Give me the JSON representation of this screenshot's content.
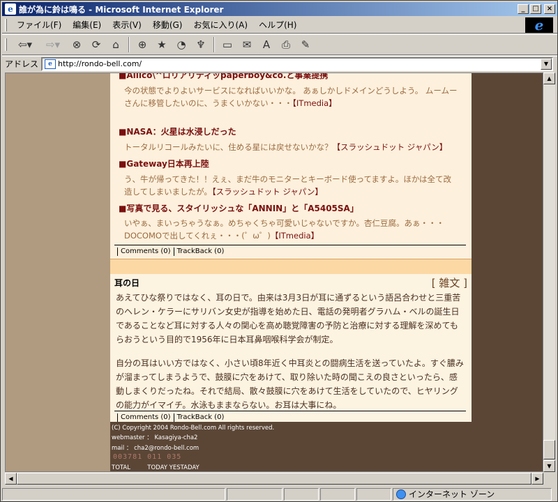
{
  "window": {
    "title": "誰が為に鈴は鳴る - Microsoft Internet Explorer",
    "icon": "ie-page-icon",
    "controls": [
      "minimize",
      "maximize",
      "close"
    ]
  },
  "menu": {
    "items": [
      "ファイル(F)",
      "編集(E)",
      "表示(V)",
      "移動(G)",
      "お気に入り(A)",
      "ヘルプ(H)"
    ]
  },
  "toolbar": {
    "buttons": [
      "back-arrow-icon",
      "forward-arrow-icon",
      "stop-icon",
      "refresh-icon",
      "home-icon",
      "search-icon",
      "favorites-icon",
      "history-icon",
      "channels-icon",
      "fullscreen-icon",
      "mail-icon",
      "font-icon",
      "print-icon",
      "edit-icon"
    ]
  },
  "address": {
    "label": "アドレス",
    "url": "http://rondo-bell.com/"
  },
  "news": [
    {
      "headline": "■Ailico\\^ロリアリティッpaperboy&co.と事業提携",
      "body": "今の状態でよりよいサービスになればいいかな。 あぁしかしドメインどうしよう。 ムームーさんに移管したいのに、うまくいかない・・・",
      "source": "【ITmedia】"
    },
    {
      "headline": "■NASA：火星は水浸しだった",
      "body": "トータルリコールみたいに、住める星には戻せないかな？",
      "source": "【スラッシュドット ジャパン】"
    },
    {
      "headline": "■Gateway日本再上陸",
      "body": "う、牛が帰ってきた！！えぇ、まだ牛のモニターとキーボード使ってますよ。ほかは全て改造してしまいましたが。",
      "source": "【スラッシュドット ジャパン】"
    },
    {
      "headline": "■写真で見る、スタイリッシュな「ANNIN」と「A5405SA」",
      "body": "いやぁ、まいっちゃうなぁ。めちゃくちゃ可愛いじゃないですか。杏仁豆腐。あぁ・・・DOCOMOで出してくれぇ・・・(゜ω゜)",
      "source": "【ITmedia】"
    }
  ],
  "meta1": {
    "comments": "Comments (0)",
    "trackback": "TrackBack (0)"
  },
  "article": {
    "title": "耳の日",
    "category": "[ 雑文 ]",
    "paragraph1": "あえてひな祭りではなく、耳の日で。由来は3月3日が耳に通ずるという語呂合わせと三重苦のヘレン・ケラーにサリバン女史が指導を始めた日、電話の発明者グラハム・ベルの誕生日であることなど耳に対する人々の関心を高め聴覚障害の予防と治療に対する理解を深めてもらおうという目的で1956年に日本耳鼻咽喉科学会が制定。",
    "paragraph2": "自分の耳はいい方ではなく、小さい頃8年近く中耳炎との闘病生活を送っていたよ。すぐ膿みが溜まってしまうようで、鼓膜に穴をあけて、取り除いた時の聞こえの良さといったら、感動しまくりだったね。それで結局、散々鼓膜に穴をあけて生活をしていたので、ヒヤリングの能力がイマイチ。水泳もままならない。お耳は大事にね。"
  },
  "meta2": {
    "comments": "Comments (0)",
    "trackback": "TrackBack (0)"
  },
  "footer": {
    "copyright": "(C) Copyright 2004 Rondo-Bell.com All rights reserved.",
    "webmaster": "webmaster ： Kasagiya-cha2",
    "mail": "mail ： cha2@rondo-bell.com",
    "counter_total": "003781",
    "counter_today": "011",
    "counter_yesterday": "035",
    "label_total": "TOTAL",
    "label_today": "TODAY",
    "label_yesterday": "YESTADAY"
  },
  "status": {
    "zone": "インターネット ゾーン"
  }
}
